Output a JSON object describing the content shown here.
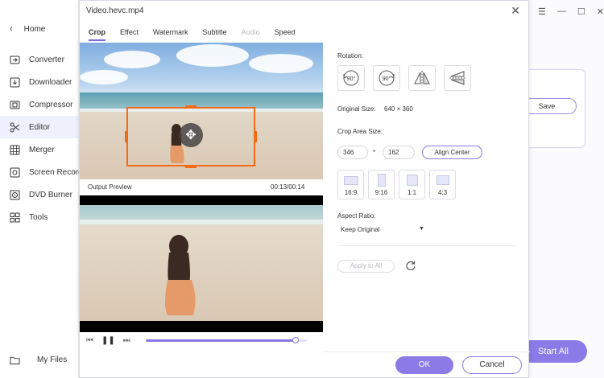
{
  "sidebar": {
    "home": "Home",
    "items": [
      {
        "label": "Converter",
        "icon": "converter-icon"
      },
      {
        "label": "Downloader",
        "icon": "downloader-icon"
      },
      {
        "label": "Compressor",
        "icon": "compressor-icon"
      },
      {
        "label": "Editor",
        "icon": "editor-icon"
      },
      {
        "label": "Merger",
        "icon": "merger-icon"
      },
      {
        "label": "Screen Recorder",
        "icon": "screen-recorder-icon"
      },
      {
        "label": "DVD Burner",
        "icon": "dvd-burner-icon"
      },
      {
        "label": "Tools",
        "icon": "tools-icon"
      }
    ],
    "my_files": "My Files"
  },
  "background": {
    "save_label": "Save",
    "start_all_label": "Start All"
  },
  "dialog": {
    "title": "Video.hevc.mp4",
    "tabs": [
      {
        "label": "Crop",
        "state": "active"
      },
      {
        "label": "Effect",
        "state": "normal"
      },
      {
        "label": "Watermark",
        "state": "normal"
      },
      {
        "label": "Subtitle",
        "state": "normal"
      },
      {
        "label": "Audio",
        "state": "disabled"
      },
      {
        "label": "Speed",
        "state": "normal"
      }
    ],
    "output_preview_label": "Output Preview",
    "time": "00:13/00:14",
    "progress": 0.93,
    "settings": {
      "rotation_label": "Rotation:",
      "rotate_left_text": "90°",
      "rotate_right_text": "90°",
      "original_size_label": "Original Size:",
      "original_size_value": "640 × 360",
      "crop_area_label": "Crop Area Size:",
      "crop_width": "346",
      "times_sign": "*",
      "crop_height": "162",
      "align_center_label": "Align Center",
      "ratios": [
        "16:9",
        "9:16",
        "1:1",
        "4:3"
      ],
      "aspect_ratio_label": "Aspect Ratio:",
      "aspect_ratio_value": "Keep Original",
      "apply_to_all_label": "Apply to All"
    },
    "ok_label": "OK",
    "cancel_label": "Cancel"
  },
  "colors": {
    "accent": "#8c7ae6",
    "crop_border": "#f36b15"
  }
}
